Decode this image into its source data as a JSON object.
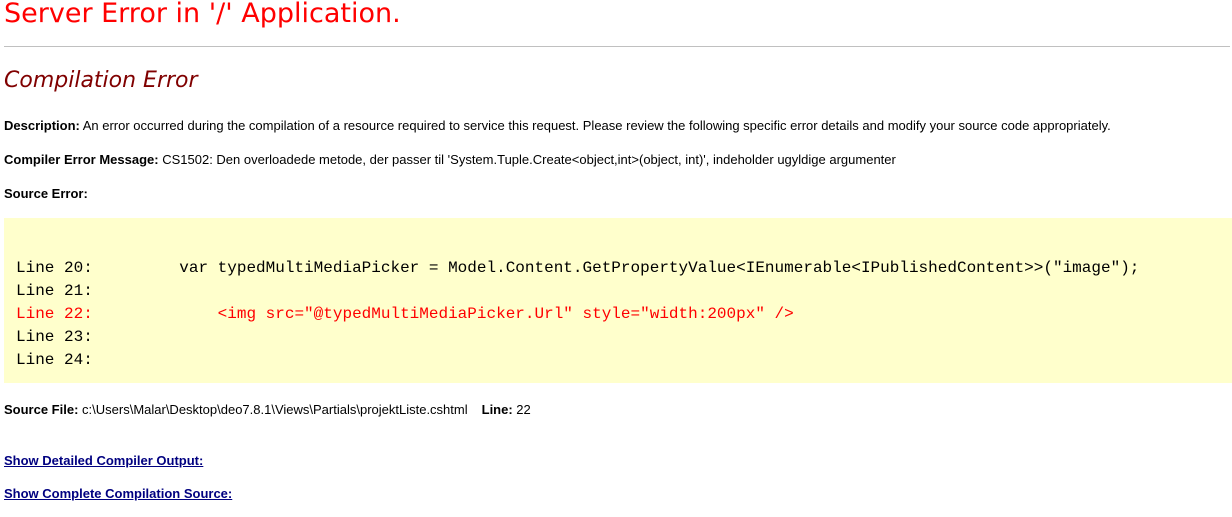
{
  "title": "Server Error in '/' Application.",
  "subtitle": "Compilation Error",
  "description": {
    "label": "Description:",
    "text": " An error occurred during the compilation of a resource required to service this request. Please review the following specific error details and modify your source code appropriately."
  },
  "compiler_message": {
    "label": "Compiler Error Message:",
    "text": " CS1502: Den overloadede metode, der passer til 'System.Tuple.Create<object,int>(object, int)', indeholder ugyldige argumenter"
  },
  "source_error": {
    "label": "Source Error:"
  },
  "code_lines": [
    {
      "number": "Line 20:",
      "code": "    var typedMultiMediaPicker = Model.Content.GetPropertyValue<IEnumerable<IPublishedContent>>(\"image\");",
      "error": false
    },
    {
      "number": "Line 21:",
      "code": "",
      "error": false
    },
    {
      "number": "Line 22:",
      "code": "        <img src=\"@typedMultiMediaPicker.Url\" style=\"width:200px\" />",
      "error": true
    },
    {
      "number": "Line 23:",
      "code": "",
      "error": false
    },
    {
      "number": "Line 24:",
      "code": "",
      "error": false
    }
  ],
  "source_file": {
    "label": "Source File:",
    "path": " c:\\Users\\Malar\\Desktop\\deo7.8.1\\Views\\Partials\\projektListe.cshtml",
    "line_label": "Line:",
    "line_value": " 22"
  },
  "links": {
    "compiler_output": "Show Detailed Compiler Output:",
    "compilation_source": "Show Complete Compilation Source:"
  },
  "colors": {
    "title": "#ff0000",
    "subtitle": "#800000",
    "code_background": "#ffffcc",
    "error_line": "#ff0000",
    "link": "#000080"
  }
}
